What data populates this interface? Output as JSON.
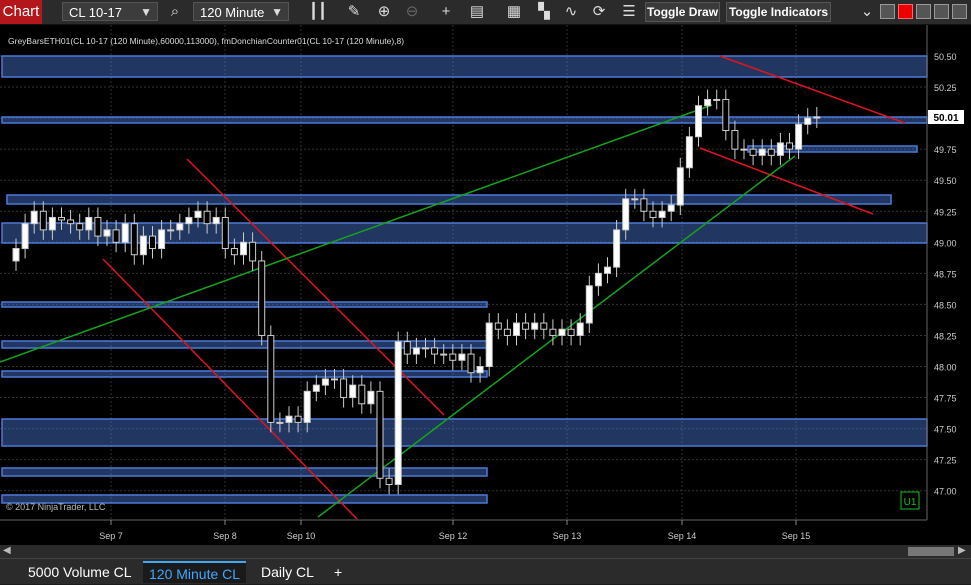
{
  "toolbar": {
    "title": "Chart",
    "instrument": "CL 10-17",
    "interval": "120 Minute",
    "toggle_draw": "Toggle Draw",
    "toggle_indicators": "Toggle Indicators"
  },
  "chart": {
    "header": "GreyBarsETH01(CL 10-17 (120 Minute),60000,113000), fmDonchianCounter01(CL 10-17 (120 Minute),8)",
    "copyright": "© 2017 NinjaTrader, LLC",
    "price_marker": "50.01",
    "badge": "U1",
    "price_axis": [
      "50.50",
      "50.25",
      "50.00",
      "49.75",
      "49.50",
      "49.25",
      "49.00",
      "48.75",
      "48.50",
      "48.25",
      "48.00",
      "47.75",
      "47.50",
      "47.25",
      "47.00"
    ],
    "time_axis": [
      "Sep 7",
      "Sep 8",
      "Sep 10",
      "Sep 12",
      "Sep 13",
      "Sep 14",
      "Sep 15"
    ],
    "colors": {
      "up": "#ffffff",
      "down": "#000000",
      "zone": "#4a7ad8",
      "trend_red": "#e0141e",
      "trend_green": "#16a31c"
    }
  },
  "tabs": [
    {
      "label": "5000 Volume CL"
    },
    {
      "label": "120 Minute CL"
    },
    {
      "label": "Daily CL"
    },
    {
      "label": "+"
    }
  ]
}
